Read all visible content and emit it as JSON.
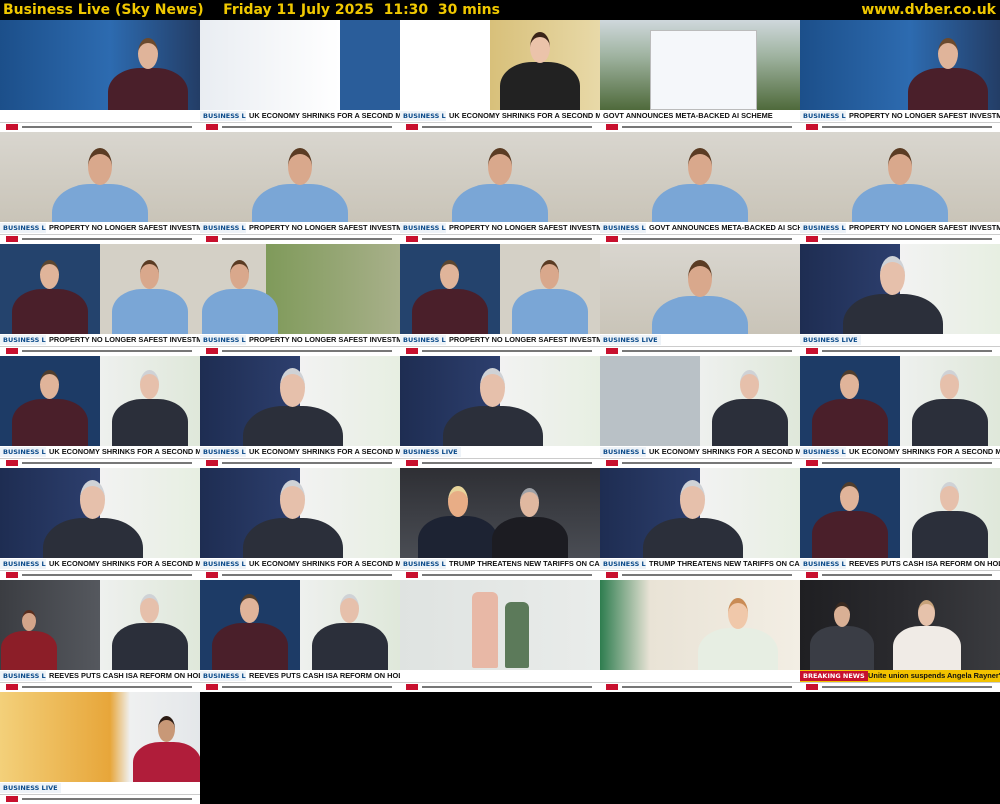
{
  "header": {
    "title": "Business Live (Sky News)    Friday 11 July 2025  11:30  30 mins",
    "site": "www.dvber.co.uk"
  },
  "colors": {
    "accent": "#f0c800",
    "background": "#000000",
    "breaking": "#f2c200",
    "sky_red": "#c8102e"
  },
  "thumbnails": [
    {
      "scene": "anchor-studio",
      "show": "",
      "headline": "",
      "breaking": false
    },
    {
      "scene": "graphic-uk-economy",
      "show": "BUSINESS LIVE",
      "headline": "UK ECONOMY SHRINKS FOR A SECOND MONTH",
      "breaking": false
    },
    {
      "scene": "quote-woman",
      "show": "BUSINESS LIVE",
      "headline": "UK ECONOMY SHRINKS FOR A SECOND MONTH",
      "breaking": false
    },
    {
      "scene": "meta-sign",
      "show": "",
      "headline": "GOVT ANNOUNCES META-BACKED AI SCHEME",
      "breaking": false
    },
    {
      "scene": "anchor-studio",
      "show": "BUSINESS LIVE",
      "headline": "PROPERTY NO LONGER SAFEST INVESTMENT?",
      "breaking": false
    },
    {
      "scene": "guest-young",
      "show": "BUSINESS LIVE",
      "headline": "PROPERTY NO LONGER SAFEST INVESTMENT?",
      "breaking": false
    },
    {
      "scene": "guest-young",
      "show": "BUSINESS LIVE",
      "headline": "PROPERTY NO LONGER SAFEST INVESTMENT?",
      "breaking": false
    },
    {
      "scene": "guest-young",
      "show": "BUSINESS LIVE",
      "headline": "PROPERTY NO LONGER SAFEST INVESTMENT?",
      "breaking": false
    },
    {
      "scene": "guest-young",
      "show": "BUSINESS LIVE",
      "headline": "GOVT ANNOUNCES META-BACKED AI SCHEME",
      "breaking": false
    },
    {
      "scene": "guest-young",
      "show": "BUSINESS LIVE",
      "headline": "PROPERTY NO LONGER SAFEST INVESTMENT?",
      "breaking": false
    },
    {
      "scene": "split-anchor-young",
      "show": "BUSINESS LIVE",
      "headline": "PROPERTY NO LONGER SAFEST INVESTMENT?",
      "breaking": false
    },
    {
      "scene": "split-young-aerial",
      "show": "BUSINESS LIVE",
      "headline": "PROPERTY NO LONGER SAFEST INVESTMENT?",
      "breaking": false
    },
    {
      "scene": "split-anchor-young",
      "show": "BUSINESS LIVE",
      "headline": "PROPERTY NO LONGER SAFEST INVESTMENT?",
      "breaking": false
    },
    {
      "scene": "guest-young",
      "show": "BUSINESS LIVE",
      "headline": "",
      "breaking": false
    },
    {
      "scene": "guest-grey",
      "show": "BUSINESS LIVE",
      "headline": "",
      "breaking": false
    },
    {
      "scene": "split-anchor-grey",
      "show": "BUSINESS LIVE",
      "headline": "UK ECONOMY SHRINKS FOR A SECOND MONTH",
      "breaking": false
    },
    {
      "scene": "guest-grey",
      "show": "BUSINESS LIVE",
      "headline": "UK ECONOMY SHRINKS FOR A SECOND MONTH",
      "breaking": false
    },
    {
      "scene": "guest-grey",
      "show": "BUSINESS LIVE",
      "headline": "",
      "breaking": false
    },
    {
      "scene": "split-crane-grey",
      "show": "BUSINESS LIVE",
      "headline": "UK ECONOMY SHRINKS FOR A SECOND MONTH",
      "breaking": false
    },
    {
      "scene": "split-anchor-grey",
      "show": "BUSINESS LIVE",
      "headline": "UK ECONOMY SHRINKS FOR A SECOND MONTH",
      "breaking": false
    },
    {
      "scene": "guest-grey",
      "show": "BUSINESS LIVE",
      "headline": "UK ECONOMY SHRINKS FOR A SECOND MONTH",
      "breaking": false
    },
    {
      "scene": "guest-grey",
      "show": "BUSINESS LIVE",
      "headline": "UK ECONOMY SHRINKS FOR A SECOND MONTH",
      "breaking": false
    },
    {
      "scene": "two-leaders",
      "show": "BUSINESS LIVE",
      "headline": "TRUMP THREATENS NEW TARIFFS ON CANADA",
      "breaking": false
    },
    {
      "scene": "guest-grey",
      "show": "BUSINESS LIVE",
      "headline": "TRUMP THREATENS NEW TARIFFS ON CANADA",
      "breaking": false
    },
    {
      "scene": "split-anchor-grey",
      "show": "BUSINESS LIVE",
      "headline": "REEVES PUTS CASH ISA REFORM ON HOLD",
      "breaking": false
    },
    {
      "scene": "split-street-grey",
      "show": "BUSINESS LIVE",
      "headline": "REEVES PUTS CASH ISA REFORM ON HOLD",
      "breaking": false
    },
    {
      "scene": "split-anchor-grey",
      "show": "BUSINESS LIVE",
      "headline": "REEVES PUTS CASH ISA REFORM ON HOLD",
      "breaking": false
    },
    {
      "scene": "product-bottles",
      "show": "",
      "headline": "",
      "breaking": false
    },
    {
      "scene": "kitchen-ad",
      "show": "",
      "headline": "",
      "breaking": false
    },
    {
      "scene": "downing-street",
      "show": "BREAKING NEWS",
      "headline": "Unite union suspends Angela Rayner's membership",
      "breaking": true
    },
    {
      "scene": "beer-woman",
      "show": "BUSINESS LIVE",
      "headline": "",
      "breaking": false
    }
  ]
}
